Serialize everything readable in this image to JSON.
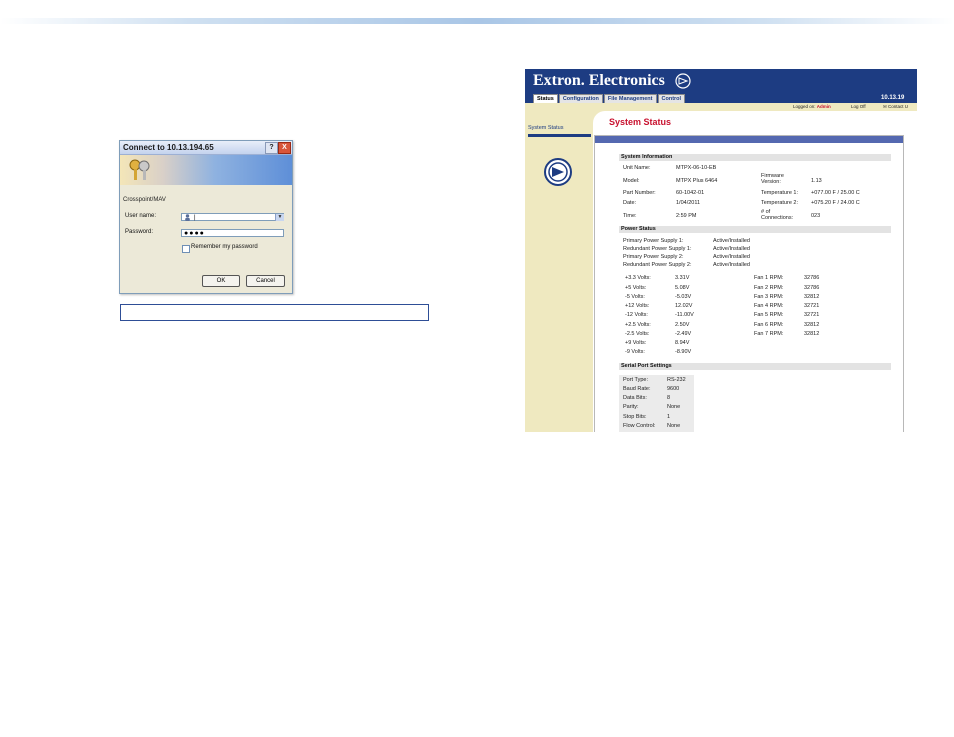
{
  "login_dialog": {
    "title": "Connect to 10.13.194.65",
    "server_name": "Crosspoint/MAV",
    "user_name_label": "User name:",
    "user_name_value": "|",
    "password_label": "Password:",
    "password_value": "●●●●",
    "remember_label": "Remember my password",
    "ok_label": "OK",
    "cancel_label": "Cancel",
    "help_label": "?",
    "close_label": "X"
  },
  "browser": {
    "brand": "Extron. Electronics",
    "tabs": [
      "Status",
      "Configuration",
      "File Management",
      "Control"
    ],
    "ip_address": "10.13.19",
    "logged_on_label": "Logged on:",
    "logged_on_user": "Admin",
    "log_off": "Log Off",
    "contact": "Contact U",
    "sidebar_item": "System Status",
    "page_title": "System Status",
    "system_information": {
      "heading": "System Information",
      "unit_name_label": "Unit Name:",
      "unit_name_value": "MTPX-06-10-EB",
      "model_label": "Model:",
      "model_value": "MTPX Plus 6464",
      "firmware_label": "Firmware Version:",
      "firmware_value": "1.13",
      "part_number_label": "Part Number:",
      "part_number_value": "60-1042-01",
      "temp1_label": "Temperature 1:",
      "temp1_value": "+077.00 F / 25.00 C",
      "date_label": "Date:",
      "date_value": "1/04/2011",
      "temp2_label": "Temperature 2:",
      "temp2_value": "+075.20 F / 24.00 C",
      "time_label": "Time:",
      "time_value": "2:59 PM",
      "connections_label": "# of Connections:",
      "connections_value": "023"
    },
    "power_status": {
      "heading": "Power Status",
      "supplies": [
        {
          "label": "Primary Power Supply 1:",
          "value": "Active/Installed"
        },
        {
          "label": "Redundant Power Supply 1:",
          "value": "Active/Installed"
        },
        {
          "label": "Primary Power Supply 2:",
          "value": "Active/Installed"
        },
        {
          "label": "Redundant Power Supply 2:",
          "value": "Active/Installed"
        }
      ],
      "voltages": [
        {
          "label": "+3.3 Volts:",
          "value": "3.31V"
        },
        {
          "label": "+5 Volts:",
          "value": "5.08V"
        },
        {
          "label": "-5 Volts:",
          "value": "-5.03V"
        },
        {
          "label": "+12 Volts:",
          "value": "12.02V"
        },
        {
          "label": "-12 Volts:",
          "value": "-11.00V"
        },
        {
          "label": "+2.5 Volts:",
          "value": "2.50V"
        },
        {
          "label": "-2.5 Volts:",
          "value": "-2.49V"
        },
        {
          "label": "+9 Volts:",
          "value": "8.94V"
        },
        {
          "label": "-9 Volts:",
          "value": "-8.90V"
        }
      ],
      "fans": [
        {
          "label": "Fan 1 RPM:",
          "value": "32786"
        },
        {
          "label": "Fan 2 RPM:",
          "value": "32786"
        },
        {
          "label": "Fan 3 RPM:",
          "value": "32812"
        },
        {
          "label": "Fan 4 RPM:",
          "value": "32721"
        },
        {
          "label": "Fan 5 RPM:",
          "value": "32721"
        },
        {
          "label": "Fan 6 RPM:",
          "value": "32812"
        },
        {
          "label": "Fan 7 RPM:",
          "value": "32812"
        }
      ]
    },
    "serial_port": {
      "heading": "Serial Port Settings",
      "rows": [
        {
          "label": "Port Type:",
          "value": "RS-232"
        },
        {
          "label": "Baud Rate:",
          "value": "9600"
        },
        {
          "label": "Data Bits:",
          "value": "8"
        },
        {
          "label": "Parity:",
          "value": "None"
        },
        {
          "label": "Stop Bits:",
          "value": "1"
        },
        {
          "label": "Flow Control:",
          "value": "None"
        }
      ]
    }
  }
}
